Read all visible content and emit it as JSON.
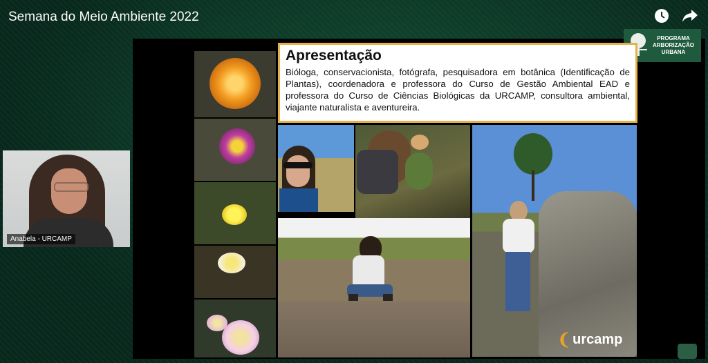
{
  "header": {
    "title": "Semana do Meio Ambiente 2022",
    "icons": [
      "clock-icon",
      "share-icon"
    ]
  },
  "program_logo": {
    "line1": "PROGRAMA",
    "line2": "ARBORIZAÇÃO",
    "line3": "URBANA"
  },
  "webcam": {
    "caption": "Anabela - URCAMP"
  },
  "slide": {
    "heading": "Apresentação",
    "body": "Bióloga, conservacionista, fotógrafa, pesquisadora em botânica (Identificação de Plantas), coordenadora e professora do Curso de Gestão Ambiental EAD e professora do Curso de Ciências Biológicas da URCAMP, consultora ambiental, viajante naturalista e aventureira.",
    "logo_text": "urcamp"
  },
  "colors": {
    "background": "#0c2f22",
    "textbox_border": "#e6b04a",
    "logo_accent": "#e8a12a"
  }
}
